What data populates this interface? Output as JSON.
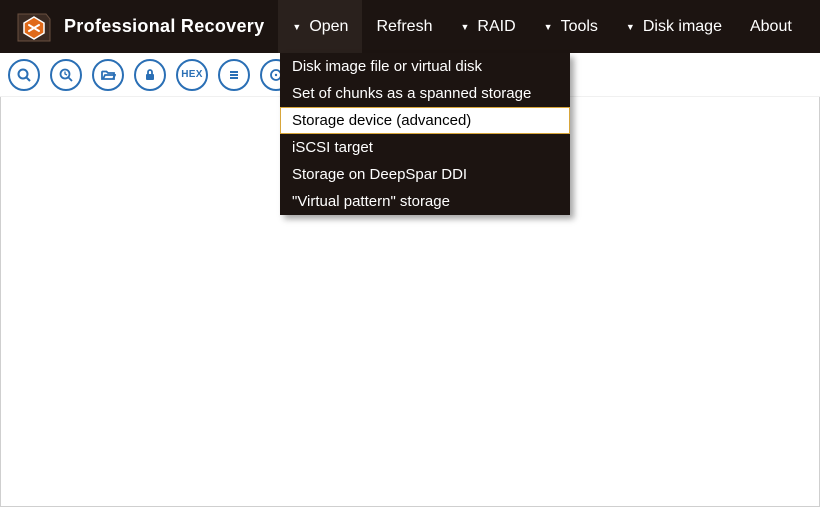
{
  "app": {
    "title": "Professional Recovery"
  },
  "menu": {
    "open": "Open",
    "refresh": "Refresh",
    "raid": "RAID",
    "tools": "Tools",
    "disk_image": "Disk image",
    "about": "About"
  },
  "open_menu": {
    "items": [
      "Disk image file or virtual disk",
      "Set of chunks as a spanned storage",
      "Storage device (advanced)",
      "iSCSI target",
      "Storage on DeepSpar DDI",
      "\"Virtual pattern\" storage"
    ],
    "highlighted_index": 2
  },
  "toolbar": {
    "icons": [
      "search-icon",
      "search-clock-icon",
      "folder-open-icon",
      "lock-icon",
      "hex-icon",
      "list-icon",
      "more-icon"
    ]
  }
}
